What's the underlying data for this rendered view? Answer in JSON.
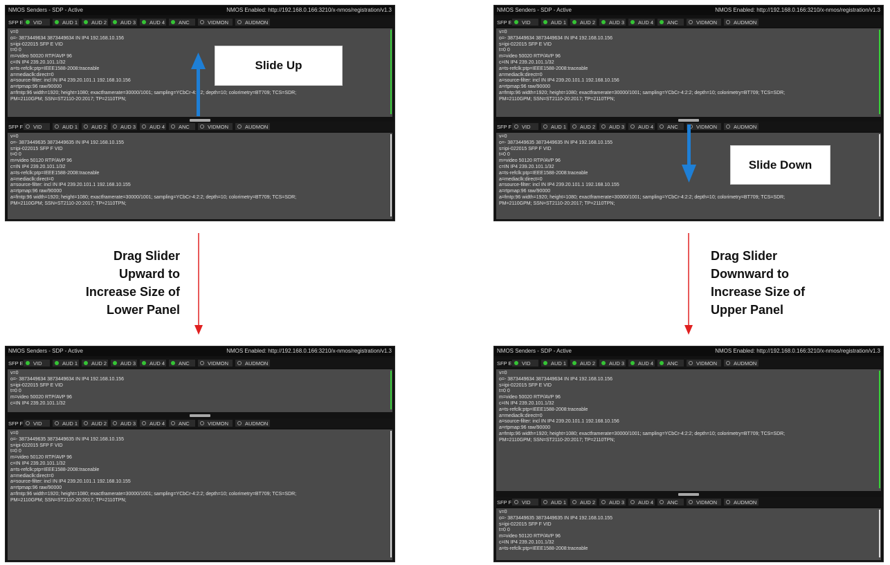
{
  "window_title": "NMOS Senders - SDP - Active",
  "nmos_status": "NMOS Enabled: http://192.168.0.166:3210/x-nmos/registration/v1.3",
  "upper_sfp": "SFP E",
  "lower_sfp": "SFP F",
  "tab_labels": [
    "VID",
    "AUD 1",
    "AUD 2",
    "AUD 3",
    "AUD 4",
    "ANC",
    "VIDMON",
    "AUDMON"
  ],
  "sdp_upper": [
    "v=0",
    "o=- 3873449634 3873449634 IN IP4 192.168.10.156",
    "s=ipi-022015 SFP E VID",
    "t=0 0",
    "m=video 50020 RTP/AVP 96",
    "c=IN IP4 239.20.101.1/32",
    "a=ts-refclk:ptp=IEEE1588-2008:traceable",
    "a=mediaclk:direct=0",
    "a=source-filter: incl IN IP4 239.20.101.1 192.168.10.156",
    "a=rtpmap:96 raw/90000",
    "a=fmtp:96 width=1920; height=1080; exactframerate=30000/1001; sampling=YCbCr-4:2:2; depth=10; colorimetry=BT709; TCS=SDR;",
    "PM=2110GPM; SSN=ST2110-20:2017; TP=2110TPN;"
  ],
  "sdp_lower": [
    "v=0",
    "o=- 3873449635 3873449635 IN IP4 192.168.10.155",
    "s=ipi-022015 SFP F VID",
    "t=0 0",
    "m=video 50120 RTP/AVP 96",
    "c=IN IP4 239.20.101.1/32",
    "a=ts-refclk:ptp=IEEE1588-2008:traceable",
    "a=mediaclk:direct=0",
    "a=source-filter: incl IN IP4 239.20.101.1 192.168.10.155",
    "a=rtpmap:96 raw/90000",
    "a=fmtp:96 width=1920; height=1080; exactframerate=30000/1001; sampling=YCbCr-4:2:2; depth=10; colorimetry=BT709; TCS=SDR;",
    "PM=2110GPM; SSN=ST2110-20:2017; TP=2110TPN;"
  ],
  "callouts": {
    "slide_up": "Slide Up",
    "slide_down": "Slide Down"
  },
  "captions": {
    "left": [
      "Drag Slider",
      "Upward to",
      "Increase Size of",
      "Lower Panel"
    ],
    "right": [
      "Drag Slider",
      "Downward to",
      "Increase Size of",
      "Upper Panel"
    ]
  },
  "colors": {
    "tab_on": "#35c435",
    "arrow_blue": "#1e7fd6",
    "arrow_red": "#e02020"
  },
  "icons": [
    "radio-on-icon",
    "radio-off-icon",
    "slider-handle-icon",
    "arrow-up-icon",
    "arrow-down-icon"
  ],
  "screens": [
    {
      "id": "top-left",
      "upper_tabs_on": [
        true,
        true,
        true,
        true,
        true,
        true,
        false,
        false
      ],
      "lower_tabs_on": [
        false,
        false,
        false,
        false,
        false,
        false,
        false,
        false
      ]
    },
    {
      "id": "top-right",
      "upper_tabs_on": [
        true,
        true,
        true,
        true,
        true,
        true,
        false,
        false
      ],
      "lower_tabs_on": [
        false,
        false,
        false,
        false,
        false,
        false,
        false,
        false
      ]
    },
    {
      "id": "bottom-left",
      "upper_tabs_on": [
        true,
        true,
        true,
        true,
        true,
        true,
        false,
        false
      ],
      "lower_tabs_on": [
        false,
        false,
        false,
        false,
        false,
        false,
        false,
        false
      ]
    },
    {
      "id": "bottom-right",
      "upper_tabs_on": [
        true,
        true,
        true,
        true,
        true,
        true,
        false,
        false
      ],
      "lower_tabs_on": [
        false,
        false,
        false,
        false,
        false,
        false,
        false,
        false
      ]
    }
  ]
}
